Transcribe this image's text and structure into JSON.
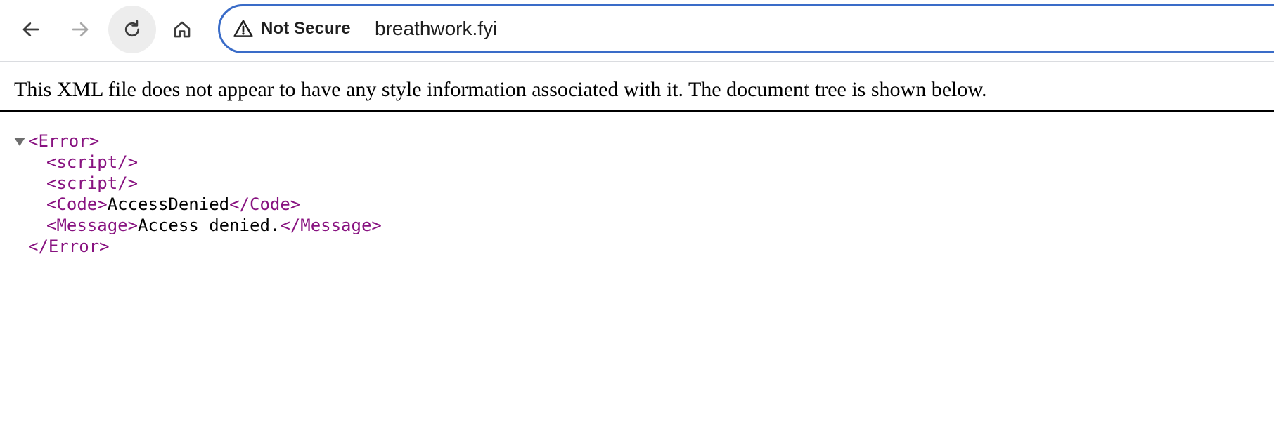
{
  "browser": {
    "security_label": "Not Secure",
    "url": "breathwork.fyi",
    "icons": {
      "back": "arrow-left-icon",
      "forward": "arrow-right-icon",
      "reload": "reload-icon",
      "home": "home-icon",
      "security": "warning-triangle-icon"
    },
    "accent_color": "#3a6cc8",
    "forward_enabled": false
  },
  "xml_viewer": {
    "notice": "This XML file does not appear to have any style information associated with it. The document tree is shown below.",
    "tree": {
      "root_open": "<Error>",
      "root_close": "</Error>",
      "children": [
        {
          "open": "<script/>"
        },
        {
          "open": "<script/>"
        },
        {
          "open": "<Code>",
          "text": "AccessDenied",
          "close": "</Code>"
        },
        {
          "open": "<Message>",
          "text": "Access denied.",
          "close": "</Message>"
        }
      ]
    },
    "tag_color": "#881280"
  }
}
